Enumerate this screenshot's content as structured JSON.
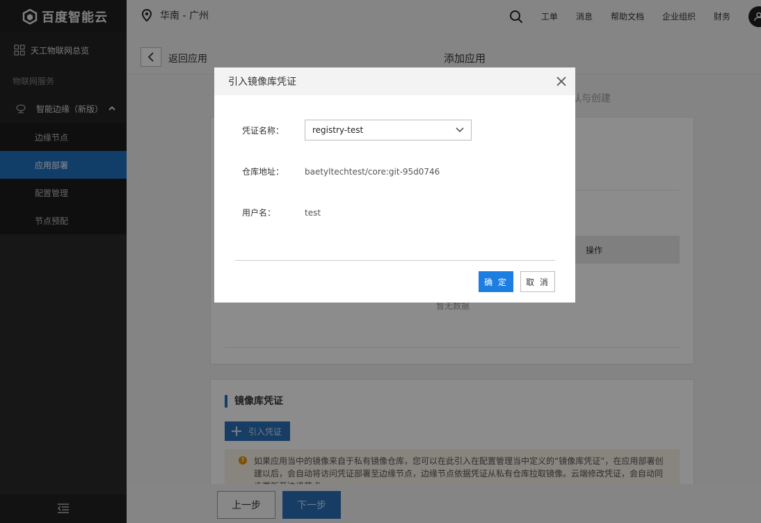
{
  "header": {
    "brand": "百度智能云",
    "region": "华南 - 广州",
    "nav": [
      "工单",
      "消息",
      "帮助文档",
      "企业组织",
      "财务"
    ]
  },
  "sidebar": {
    "overview": "天工物联网总览",
    "section": "物联网服务",
    "group": "智能边缘（新版）",
    "items": [
      {
        "label": "边缘节点",
        "active": false
      },
      {
        "label": "应用部署",
        "active": true
      },
      {
        "label": "配置管理",
        "active": false
      },
      {
        "label": "节点预配",
        "active": false
      }
    ]
  },
  "page": {
    "back_label": "返回应用",
    "title": "添加应用",
    "step_label": "认与创建",
    "table_header_op": "操作",
    "empty_text": "暂无数据",
    "registry_section_title": "镜像库凭证",
    "import_button": "引入凭证",
    "tip_text": "如果应用当中的镜像来自于私有镜像仓库，您可以在此引入在配置管理当中定义的“镜像库凭证”，在应用部署创建以后，会自动将访问凭证部署至边缘节点，边缘节点依据凭证从私有仓库拉取镜像。云端修改凭证，会自动同步更新至边缘节点",
    "prev_button": "上一步",
    "next_button": "下一步"
  },
  "modal": {
    "title": "引入镜像库凭证",
    "fields": {
      "name_label": "凭证名称：",
      "name_value": "registry-test",
      "address_label": "仓库地址：",
      "address_value": "baetyltechtest/core:git-95d0746",
      "user_label": "用户名：",
      "user_value": "test"
    },
    "ok_button": "确 定",
    "cancel_button": "取 消"
  },
  "colors": {
    "primary": "#1b7ee0",
    "sidebar_active": "#1f6fbf",
    "sidebar_bg": "#2a2a2a",
    "warning": "#e8930d"
  }
}
